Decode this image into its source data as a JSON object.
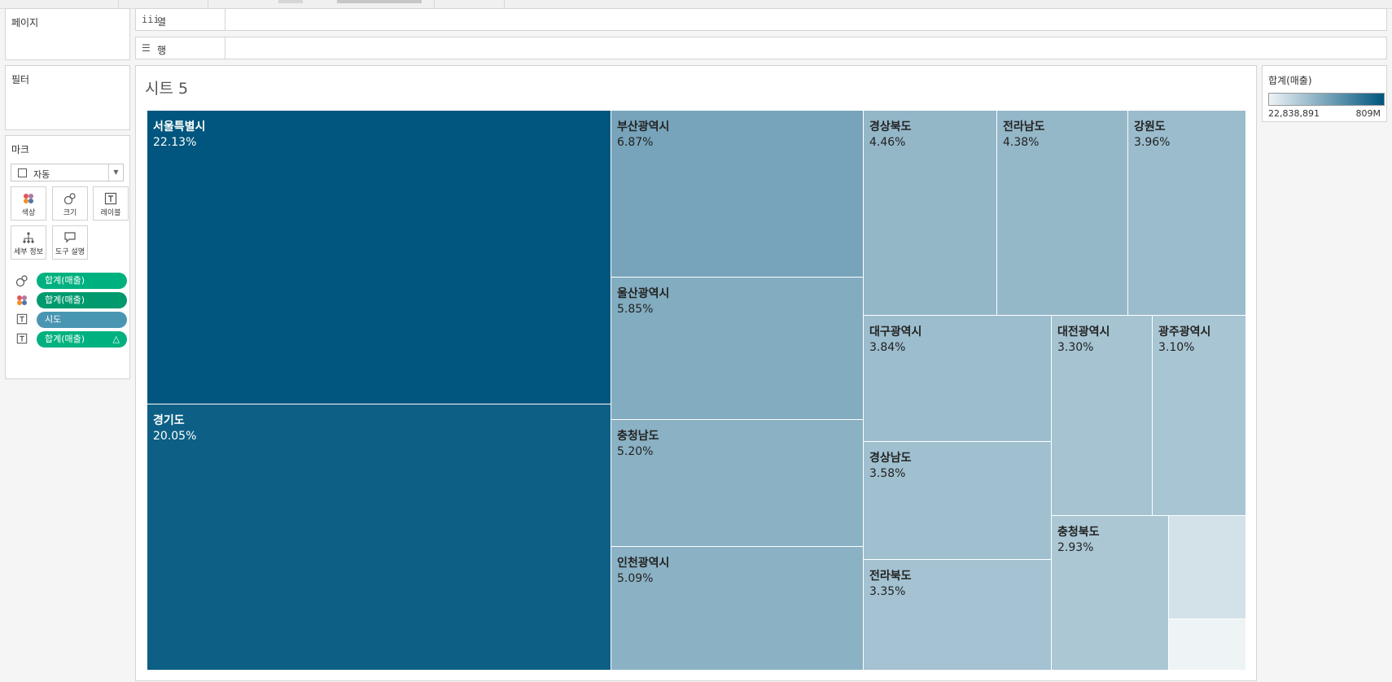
{
  "shelves": {
    "pages_title": "페이지",
    "filters_title": "필터",
    "columns_label": "열",
    "rows_label": "행"
  },
  "marks": {
    "title": "마크",
    "mark_type": "자동",
    "buttons": {
      "color": "색상",
      "size": "크기",
      "label": "레이블",
      "detail": "세부 정보",
      "tooltip": "도구 설명"
    },
    "pills": [
      {
        "icon": "size-icon",
        "text": "합계(매출)",
        "color": "#00b180"
      },
      {
        "icon": "color-icon",
        "text": "합계(매출)",
        "color": "#009a6e"
      },
      {
        "icon": "label-icon",
        "text": "시도",
        "color": "#4996b2"
      },
      {
        "icon": "label-icon",
        "text": "합계(매출)",
        "color": "#00b180",
        "delta": "△"
      }
    ]
  },
  "sheet": {
    "title": "시트 5"
  },
  "legend": {
    "title": "합계(매출)",
    "min": "22,838,891",
    "max": "809M",
    "color_low": "#eef3f6",
    "color_high": "#00567e"
  },
  "chart_data": {
    "type": "treemap",
    "metric": "합계(매출)",
    "items": [
      {
        "name": "서울특별시",
        "pct": "22.13%",
        "value": 22.13
      },
      {
        "name": "경기도",
        "pct": "20.05%",
        "value": 20.05
      },
      {
        "name": "부산광역시",
        "pct": "6.87%",
        "value": 6.87
      },
      {
        "name": "울산광역시",
        "pct": "5.85%",
        "value": 5.85
      },
      {
        "name": "충청남도",
        "pct": "5.20%",
        "value": 5.2
      },
      {
        "name": "인천광역시",
        "pct": "5.09%",
        "value": 5.09
      },
      {
        "name": "경상북도",
        "pct": "4.46%",
        "value": 4.46
      },
      {
        "name": "전라남도",
        "pct": "4.38%",
        "value": 4.38
      },
      {
        "name": "강원도",
        "pct": "3.96%",
        "value": 3.96
      },
      {
        "name": "대구광역시",
        "pct": "3.84%",
        "value": 3.84
      },
      {
        "name": "경상남도",
        "pct": "3.58%",
        "value": 3.58
      },
      {
        "name": "전라북도",
        "pct": "3.35%",
        "value": 3.35
      },
      {
        "name": "대전광역시",
        "pct": "3.30%",
        "value": 3.3
      },
      {
        "name": "광주광역시",
        "pct": "3.10%",
        "value": 3.1
      },
      {
        "name": "충청북도",
        "pct": "2.93%",
        "value": 2.93
      },
      {
        "name": "",
        "pct": "",
        "value": 1.2
      },
      {
        "name": "",
        "pct": "",
        "value": 0.8
      }
    ]
  }
}
